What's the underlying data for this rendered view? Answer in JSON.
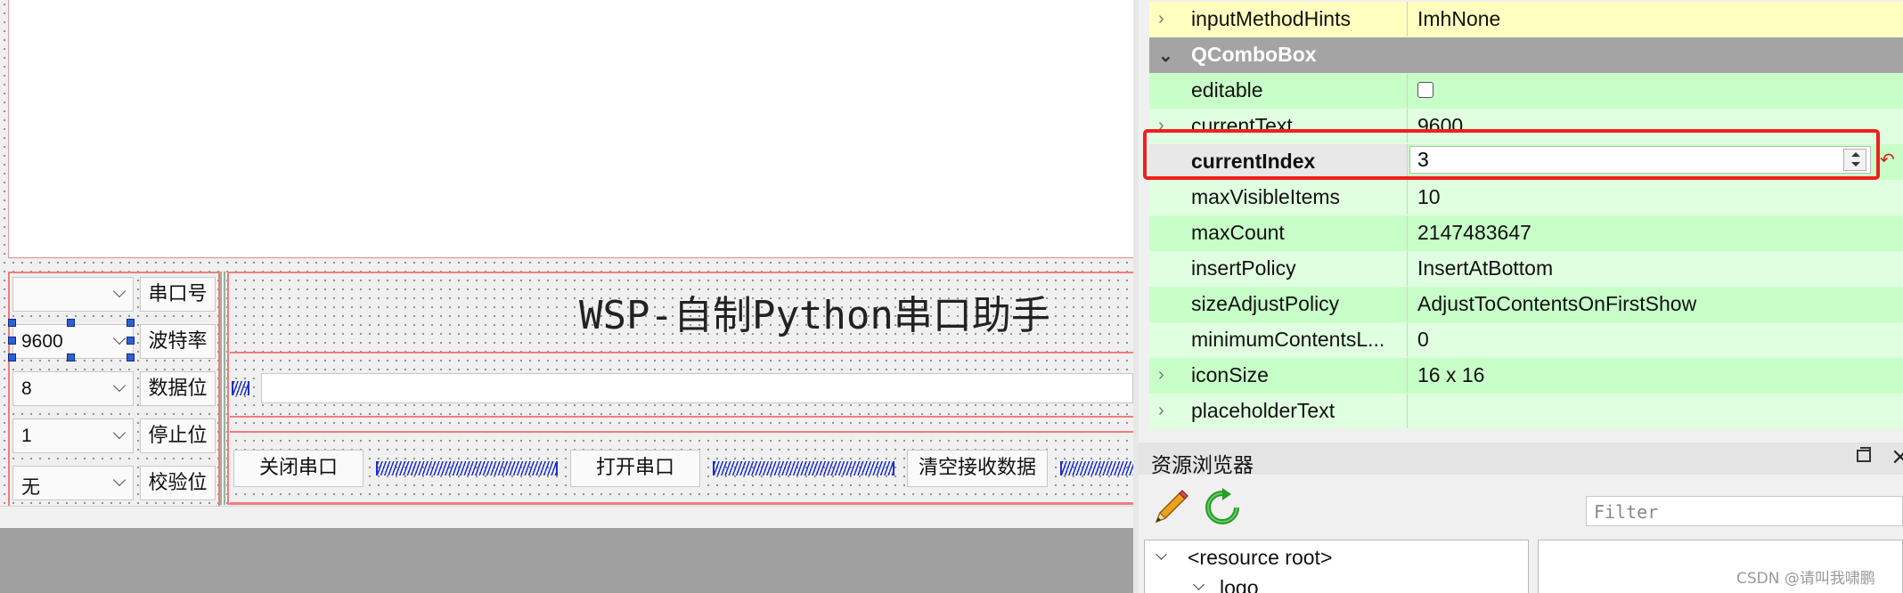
{
  "designer": {
    "title_label": "WSP-自制Python串口助手",
    "serial_rows": [
      {
        "value": "",
        "label": "串口号"
      },
      {
        "value": "9600",
        "label": "波特率"
      },
      {
        "value": "8",
        "label": "数据位"
      },
      {
        "value": "1",
        "label": "停止位"
      },
      {
        "value": "无",
        "label": "校验位"
      }
    ],
    "buttons": {
      "close_port": "关闭串口",
      "open_port": "打开串口",
      "clear_receive": "清空接收数据"
    }
  },
  "property_editor": {
    "rows": [
      {
        "name": "inputMethodHints",
        "value": "ImhNone",
        "expandable": true
      },
      {
        "name": "QComboBox",
        "value": "",
        "group": true
      },
      {
        "name": "editable",
        "value": "",
        "checkbox": true
      },
      {
        "name": "currentText",
        "value": "9600",
        "expandable": true
      },
      {
        "name": "currentIndex",
        "value": "3",
        "selected": true
      },
      {
        "name": "maxVisibleItems",
        "value": "10"
      },
      {
        "name": "maxCount",
        "value": "2147483647"
      },
      {
        "name": "insertPolicy",
        "value": "InsertAtBottom"
      },
      {
        "name": "sizeAdjustPolicy",
        "value": "AdjustToContentsOnFirstShow"
      },
      {
        "name": "minimumContentsL...",
        "value": "0"
      },
      {
        "name": "iconSize",
        "value": "16 x 16",
        "expandable": true
      },
      {
        "name": "placeholderText",
        "value": "",
        "expandable": true
      }
    ],
    "highlight_color": "#f0201c"
  },
  "resource_browser": {
    "title": "资源浏览器",
    "filter_placeholder": "Filter",
    "tree": [
      {
        "label": "<resource root>"
      },
      {
        "label": "logo"
      }
    ]
  },
  "watermark": "CSDN @请叫我啸鹏"
}
